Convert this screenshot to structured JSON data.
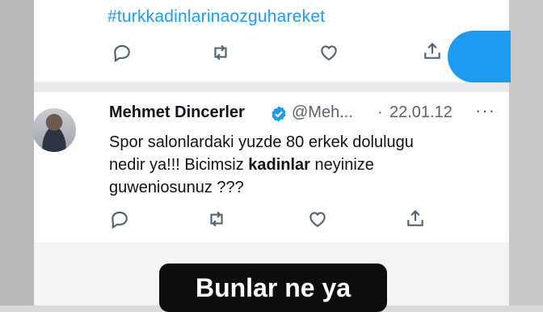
{
  "previous_tweet": {
    "hashtag": "#turkkadinlarinaozguhareket"
  },
  "tweet": {
    "author_name": "Mehmet Dincerler",
    "handle": "@Meh...",
    "separator": "·",
    "date": "22.01.12",
    "more": "···",
    "body_line1": "Spor salonlardaki yuzde 80 erkek dolulugu",
    "body_line2_pre": "nedir ya!!! Bicimsiz ",
    "body_line2_bold": "kadinlar",
    "body_line2_post": " neyinize",
    "body_line3": "guweniosunuz ???"
  },
  "caption": {
    "text": "Bunlar ne ya"
  },
  "colors": {
    "accent": "#1d9bf0",
    "icon": "#536471",
    "text": "#0f1419"
  },
  "icons": [
    "reply-icon",
    "retweet-icon",
    "like-icon",
    "share-icon",
    "verified-badge-icon",
    "more-icon"
  ]
}
